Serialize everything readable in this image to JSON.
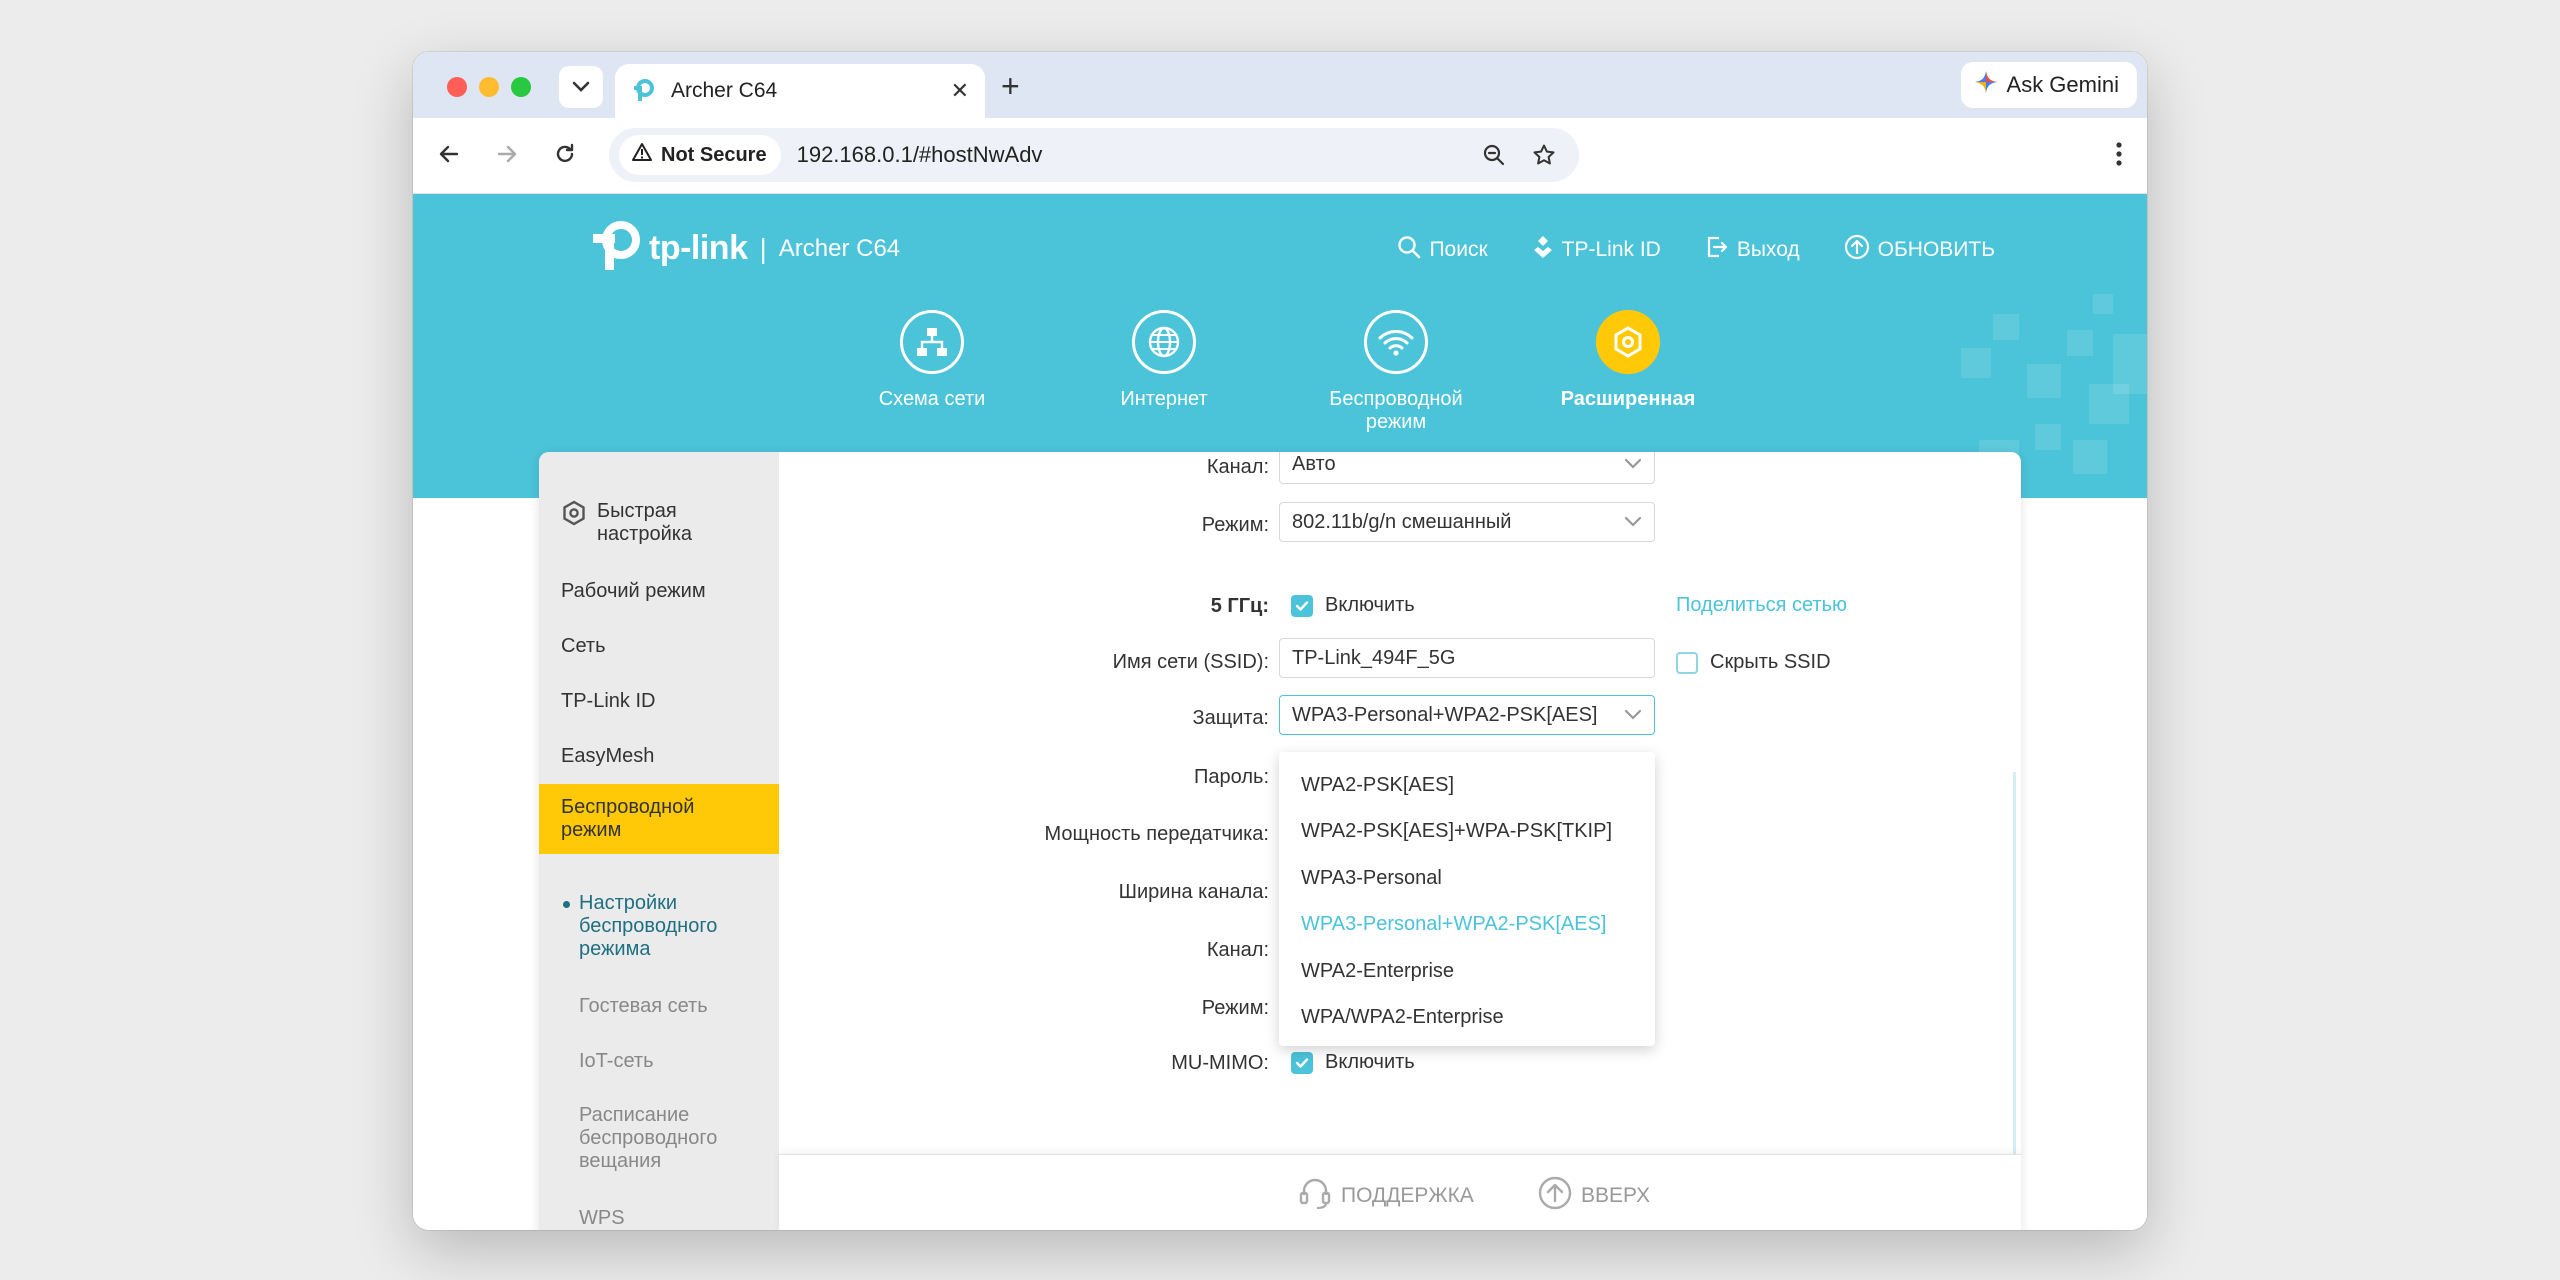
{
  "browser": {
    "tab_title": "Archer C64",
    "gemini_label": "Ask Gemini",
    "not_secure_label": "Not Secure",
    "url": "192.168.0.1/#hostNwAdv"
  },
  "header": {
    "logo_text": "tp-link",
    "separator": "|",
    "model": "Archer C64",
    "links": {
      "search": "Поиск",
      "tplink_id": "TP-Link ID",
      "logout": "Выход",
      "update": "ОБНОВИТЬ"
    }
  },
  "main_nav": {
    "network_map": "Схема сети",
    "internet": "Интернет",
    "wireless_line1": "Беспроводной",
    "wireless_line2": "режим",
    "advanced": "Расширенная"
  },
  "sidebar": {
    "quick_setup_line1": "Быстрая",
    "quick_setup_line2": "настройка",
    "operation_mode": "Рабочий режим",
    "network": "Сеть",
    "tplink_id": "TP-Link ID",
    "easymesh": "EasyMesh",
    "wireless_line1": "Беспроводной",
    "wireless_line2": "режим",
    "sub_settings_line1": "Настройки",
    "sub_settings_line2": "беспроводного",
    "sub_settings_line3": "режима",
    "sub_guest": "Гостевая сеть",
    "sub_iot": "IoT-сеть",
    "sub_schedule_line1": "Расписание",
    "sub_schedule_line2": "беспроводного",
    "sub_schedule_line3": "вещания",
    "sub_wps": "WPS"
  },
  "form": {
    "channel_label": "Канал:",
    "channel_value": "Авто",
    "mode_label": "Режим:",
    "mode_value": "802.11b/g/n смешанный",
    "band_label": "5 ГГц:",
    "enable_label": "Включить",
    "share_network": "Поделиться сетью",
    "ssid_label": "Имя сети (SSID):",
    "ssid_value": "TP-Link_494F_5G",
    "hide_ssid": "Скрыть SSID",
    "security_label": "Защита:",
    "security_value": "WPA3-Personal+WPA2-PSK[AES]",
    "password_label": "Пароль:",
    "tx_power_label": "Мощность передатчика:",
    "channel_width_label": "Ширина канала:",
    "channel2_label": "Канал:",
    "mode2_label": "Режим:",
    "mumimo_label": "MU-MIMO:",
    "mumimo_enable": "Включить"
  },
  "security_options": [
    "WPA2-PSK[AES]",
    "WPA2-PSK[AES]+WPA-PSK[TKIP]",
    "WPA3-Personal",
    "WPA3-Personal+WPA2-PSK[AES]",
    "WPA2-Enterprise",
    "WPA/WPA2-Enterprise"
  ],
  "footer": {
    "support": "ПОДДЕРЖКА",
    "back_to_top": "ВВЕРХ"
  },
  "colors": {
    "brand_teal": "#4bc3d9",
    "active_yellow": "#ffc907"
  }
}
